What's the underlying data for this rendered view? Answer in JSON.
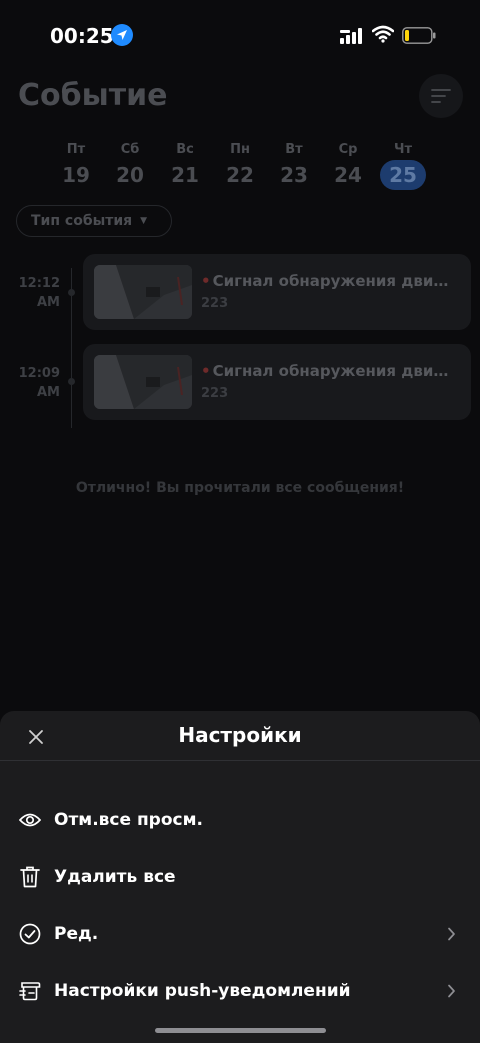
{
  "status_bar": {
    "time": "00:25"
  },
  "page": {
    "title": "Событие",
    "days": [
      {
        "name": "Пт",
        "num": "19",
        "active": false
      },
      {
        "name": "Сб",
        "num": "20",
        "active": false
      },
      {
        "name": "Вс",
        "num": "21",
        "active": false
      },
      {
        "name": "Пн",
        "num": "22",
        "active": false
      },
      {
        "name": "Вт",
        "num": "23",
        "active": false
      },
      {
        "name": "Ср",
        "num": "24",
        "active": false
      },
      {
        "name": "Чт",
        "num": "25",
        "active": true
      }
    ],
    "type_filter": "Тип события",
    "events": [
      {
        "time": "12:12",
        "ampm": "AM",
        "title": "Сигнал обнаружения движения",
        "sub": "223"
      },
      {
        "time": "12:09",
        "ampm": "AM",
        "title": "Сигнал обнаружения движения",
        "sub": "223"
      }
    ],
    "all_read": "Отлично! Вы прочитали все сообщения!"
  },
  "sheet": {
    "title": "Настройки",
    "items": [
      {
        "label": "Отм.все просм.",
        "icon": "eye-icon",
        "chevron": false
      },
      {
        "label": "Удалить все",
        "icon": "trash-icon",
        "chevron": false
      },
      {
        "label": "Ред.",
        "icon": "check-circle-icon",
        "chevron": true
      },
      {
        "label": "Настройки push-уведомлений",
        "icon": "notification-settings-icon",
        "chevron": true
      }
    ]
  },
  "colors": {
    "accent": "#1f8bff",
    "active_day": "#1d3c6e",
    "sheet_bg": "#1c1c1e"
  }
}
